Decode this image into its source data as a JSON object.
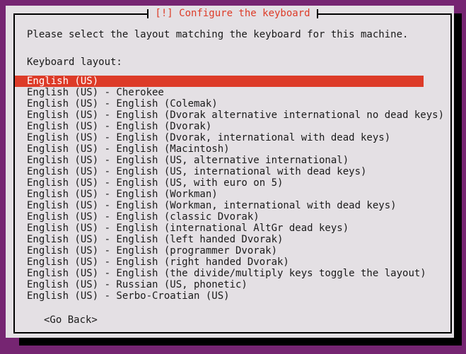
{
  "window": {
    "title": "[!] Configure the keyboard",
    "title_color": "#dd3b28",
    "background_color": "#762572",
    "dialog_background": "#e4e0e4",
    "border_color": "#000000"
  },
  "content": {
    "intro_text": "Please select the layout matching the keyboard for this machine.",
    "list_label": "Keyboard layout:",
    "selected_index": 0,
    "selection_color": "#dd3b28",
    "selection_text_color": "#ffffff",
    "layouts": [
      "English (US)",
      "English (US) - Cherokee",
      "English (US) - English (Colemak)",
      "English (US) - English (Dvorak alternative international no dead keys)",
      "English (US) - English (Dvorak)",
      "English (US) - English (Dvorak, international with dead keys)",
      "English (US) - English (Macintosh)",
      "English (US) - English (US, alternative international)",
      "English (US) - English (US, international with dead keys)",
      "English (US) - English (US, with euro on 5)",
      "English (US) - English (Workman)",
      "English (US) - English (Workman, international with dead keys)",
      "English (US) - English (classic Dvorak)",
      "English (US) - English (international AltGr dead keys)",
      "English (US) - English (left handed Dvorak)",
      "English (US) - English (programmer Dvorak)",
      "English (US) - English (right handed Dvorak)",
      "English (US) - English (the divide/multiply keys toggle the layout)",
      "English (US) - Russian (US, phonetic)",
      "English (US) - Serbo-Croatian (US)"
    ]
  },
  "buttons": {
    "go_back": "<Go Back>"
  }
}
